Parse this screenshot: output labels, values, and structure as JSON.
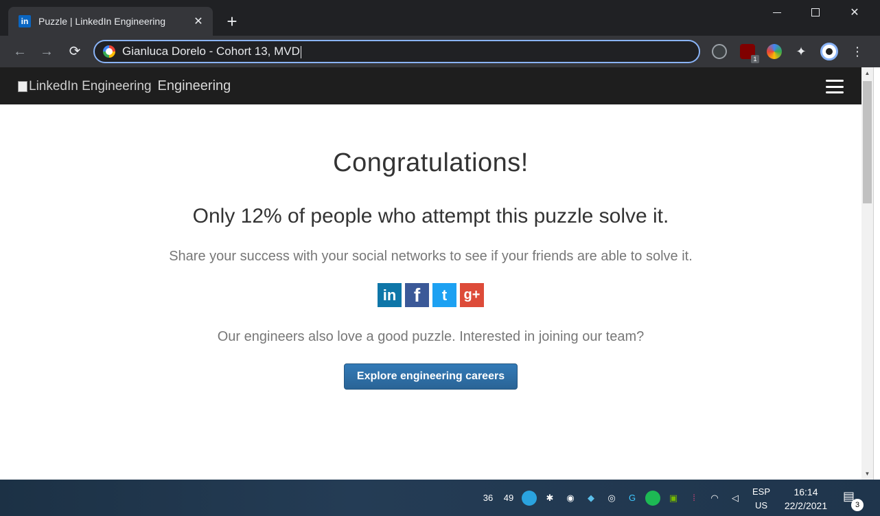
{
  "browser": {
    "tab": {
      "favicon": "in",
      "title": "Puzzle | LinkedIn Engineering",
      "close": "✕"
    },
    "new_tab": "+",
    "address": "Gianluca Dorelo - Cohort 13, MVD",
    "nav": {
      "back": "←",
      "forward": "→",
      "reload": "⟳"
    },
    "extensions": {
      "ublock_badge": "1",
      "puzzle_glyph": "✦"
    },
    "menu_glyph": "⋮",
    "window": {
      "close": "✕"
    }
  },
  "site": {
    "logo_alt": "LinkedIn Engineering",
    "logo_word": "Engineering"
  },
  "main": {
    "headline": "Congratulations!",
    "stat": "Only 12% of people who attempt this puzzle solve it.",
    "share_prompt": "Share your success with your social networks to see if your friends are able to solve it.",
    "social": {
      "linkedin": "in",
      "facebook": "f",
      "twitter": "t",
      "googleplus": "g+"
    },
    "join_prompt": "Our engineers also love a good puzzle. Interested in joining our team?",
    "cta": "Explore engineering careers"
  },
  "taskbar": {
    "tray_labels": [
      "36",
      "49"
    ],
    "lang_top": "ESP",
    "lang_bottom": "US",
    "time": "16:14",
    "date": "22/2/2021",
    "notifications": "3"
  },
  "colors": {
    "brand_blue": "#0a66c2",
    "cta_blue": "#337ab7",
    "focus_ring": "#8ab4f8"
  }
}
